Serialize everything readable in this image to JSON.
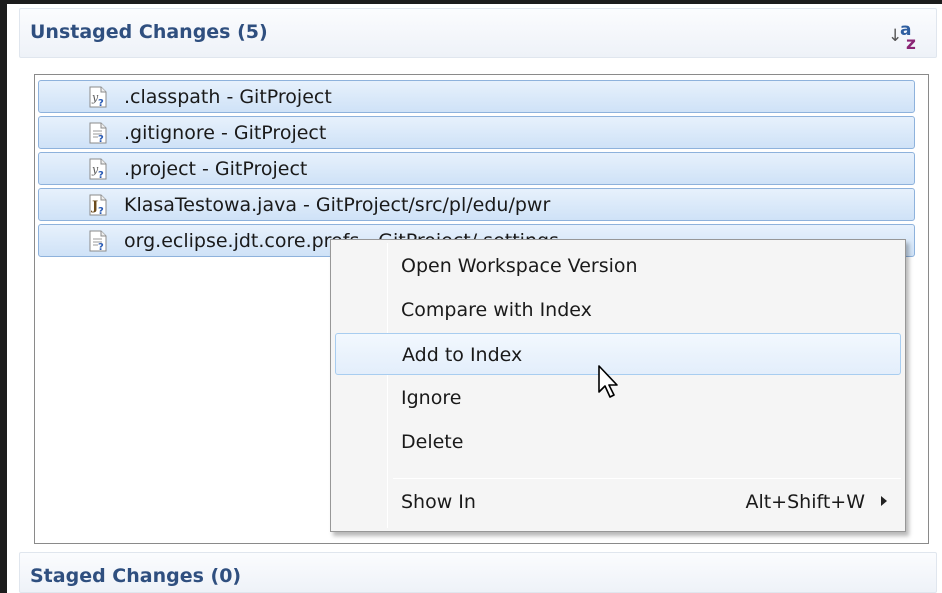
{
  "unstaged": {
    "title": "Unstaged Changes (5)",
    "files": [
      {
        "label": ".classpath - GitProject",
        "icon": "xml-file-untracked-icon"
      },
      {
        "label": ".gitignore - GitProject",
        "icon": "text-file-untracked-icon"
      },
      {
        "label": ".project - GitProject",
        "icon": "xml-file-untracked-icon"
      },
      {
        "label": "KlasaTestowa.java - GitProject/src/pl/edu/pwr",
        "icon": "java-file-untracked-icon"
      },
      {
        "label": "org.eclipse.jdt.core.prefs - GitProject/.settings",
        "icon": "text-file-untracked-icon"
      }
    ]
  },
  "staged": {
    "title": "Staged Changes (0)"
  },
  "context_menu": {
    "items": [
      {
        "label": "Open Workspace Version"
      },
      {
        "label": "Compare with Index"
      },
      {
        "label": "Add to Index",
        "hovered": true
      },
      {
        "label": "Ignore"
      },
      {
        "label": "Delete"
      },
      {
        "label": "Show In",
        "shortcut": "Alt+Shift+W"
      }
    ]
  },
  "colors": {
    "section_title": "#2f4f7f",
    "selection_fill": "#cfe2f7",
    "selection_border": "#8eb2dc",
    "menu_hover_border": "#a8cdf0"
  }
}
